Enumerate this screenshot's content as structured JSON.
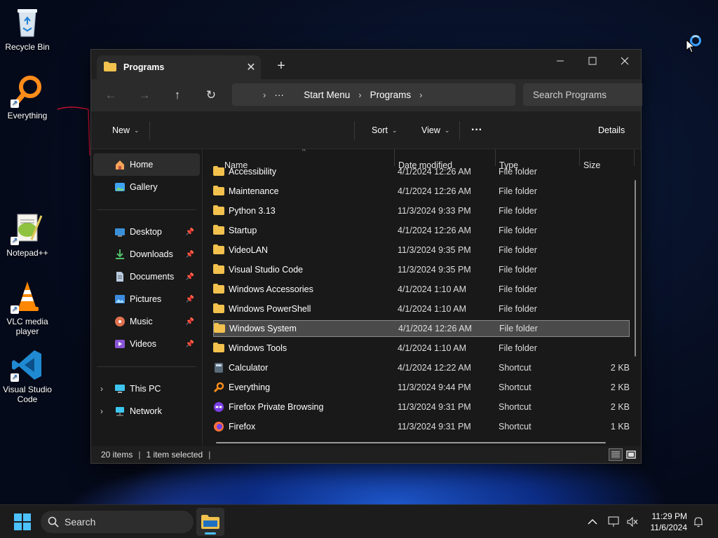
{
  "desktop": {
    "icons": [
      {
        "label": "Recycle Bin",
        "icon": "recycle-bin-icon"
      },
      {
        "label": "Everything",
        "icon": "everything-search-icon"
      },
      {
        "label": "Notepad++",
        "icon": "notepad-plus-plus-icon"
      },
      {
        "label": "VLC media player",
        "icon": "vlc-cone-icon"
      },
      {
        "label": "Visual Studio Code",
        "icon": "vscode-icon"
      }
    ]
  },
  "window": {
    "tab_title": "Programs",
    "new_tab": "+",
    "breadcrumb": {
      "more": "···",
      "items": [
        "Start Menu",
        "Programs"
      ]
    },
    "search_placeholder": "Search Programs",
    "toolbar": {
      "new_label": "New",
      "sort_label": "Sort",
      "view_label": "View",
      "more_label": "···",
      "details_label": "Details"
    },
    "sidebar": {
      "items": [
        {
          "label": "Home",
          "icon": "home-icon",
          "active": true
        },
        {
          "label": "Gallery",
          "icon": "gallery-icon"
        },
        {
          "label": "Desktop",
          "icon": "desktop-folder-icon",
          "pinned": true
        },
        {
          "label": "Downloads",
          "icon": "downloads-icon",
          "pinned": true
        },
        {
          "label": "Documents",
          "icon": "documents-icon",
          "pinned": true
        },
        {
          "label": "Pictures",
          "icon": "pictures-icon",
          "pinned": true
        },
        {
          "label": "Music",
          "icon": "music-icon",
          "pinned": true
        },
        {
          "label": "Videos",
          "icon": "videos-icon",
          "pinned": true
        },
        {
          "label": "This PC",
          "icon": "this-pc-icon",
          "expandable": true
        },
        {
          "label": "Network",
          "icon": "network-icon",
          "expandable": true
        }
      ]
    },
    "columns": {
      "name": "Name",
      "date": "Date modified",
      "type": "Type",
      "size": "Size"
    },
    "files": [
      {
        "name": "Accessibility",
        "date": "4/1/2024 12:26 AM",
        "type": "File folder",
        "size": "",
        "icon": "folder-icon"
      },
      {
        "name": "Maintenance",
        "date": "4/1/2024 12:26 AM",
        "type": "File folder",
        "size": "",
        "icon": "folder-icon"
      },
      {
        "name": "Python 3.13",
        "date": "11/3/2024 9:33 PM",
        "type": "File folder",
        "size": "",
        "icon": "folder-icon"
      },
      {
        "name": "Startup",
        "date": "4/1/2024 12:26 AM",
        "type": "File folder",
        "size": "",
        "icon": "folder-icon"
      },
      {
        "name": "VideoLAN",
        "date": "11/3/2024 9:35 PM",
        "type": "File folder",
        "size": "",
        "icon": "folder-icon"
      },
      {
        "name": "Visual Studio Code",
        "date": "11/3/2024 9:35 PM",
        "type": "File folder",
        "size": "",
        "icon": "folder-icon"
      },
      {
        "name": "Windows Accessories",
        "date": "4/1/2024 1:10 AM",
        "type": "File folder",
        "size": "",
        "icon": "folder-icon"
      },
      {
        "name": "Windows PowerShell",
        "date": "4/1/2024 1:10 AM",
        "type": "File folder",
        "size": "",
        "icon": "folder-icon"
      },
      {
        "name": "Windows System",
        "date": "4/1/2024 12:26 AM",
        "type": "File folder",
        "size": "",
        "icon": "folder-icon",
        "selected": true
      },
      {
        "name": "Windows Tools",
        "date": "4/1/2024 1:10 AM",
        "type": "File folder",
        "size": "",
        "icon": "folder-icon"
      },
      {
        "name": "Calculator",
        "date": "4/1/2024 12:22 AM",
        "type": "Shortcut",
        "size": "2 KB",
        "icon": "calculator-shortcut-icon"
      },
      {
        "name": "Everything",
        "date": "11/3/2024 9:44 PM",
        "type": "Shortcut",
        "size": "2 KB",
        "icon": "everything-shortcut-icon"
      },
      {
        "name": "Firefox Private Browsing",
        "date": "11/3/2024 9:31 PM",
        "type": "Shortcut",
        "size": "2 KB",
        "icon": "firefox-private-icon"
      },
      {
        "name": "Firefox",
        "date": "11/3/2024 9:31 PM",
        "type": "Shortcut",
        "size": "1 KB",
        "icon": "firefox-icon"
      }
    ],
    "status": {
      "item_count": "20 items",
      "selection": "1 item selected"
    }
  },
  "taskbar": {
    "search_placeholder": "Search",
    "time": "11:29 PM",
    "date": "11/6/2024"
  },
  "colors": {
    "accent": "#4cc2ff",
    "folder": "#f2c14e",
    "window_bg": "#191919"
  }
}
